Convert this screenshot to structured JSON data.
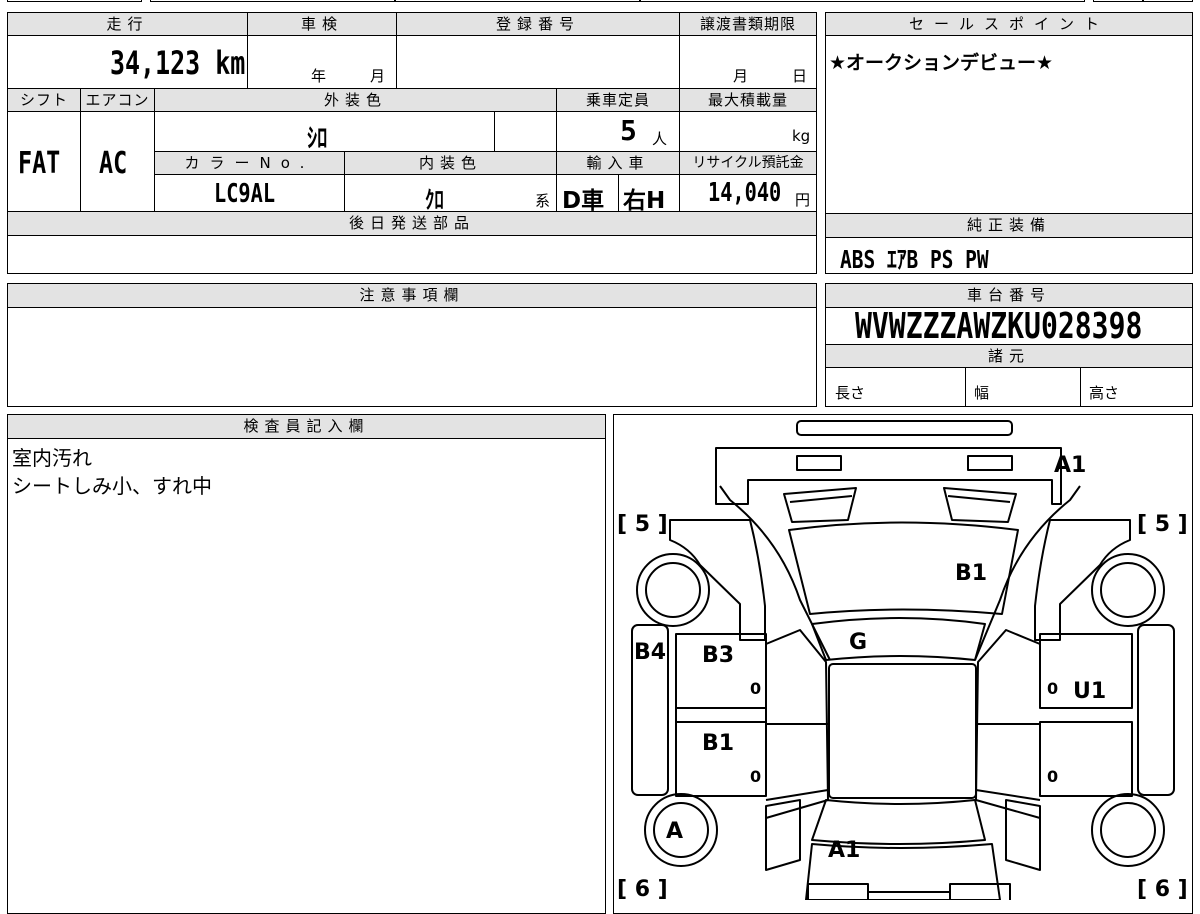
{
  "headers": {
    "mileage": "走行",
    "inspection": "車検",
    "reg_no": "登録番号",
    "transfer_deadline": "譲渡書類期限",
    "sales_point": "セールスポイント",
    "shift": "シフト",
    "aircon": "エアコン",
    "ext_color": "外装色",
    "capacity": "乗車定員",
    "max_load": "最大積載量",
    "color_no": "カラーNo.",
    "int_color": "内装色",
    "import": "輸入車",
    "recycle": "リサイクル預託金",
    "later_parts": "後日発送部品",
    "genuine_equipment": "純正装備",
    "notes": "注意事項欄",
    "chassis_no": "車台番号",
    "specs": "諸元",
    "inspector": "検査員記入欄"
  },
  "values": {
    "mileage": "34,123 km",
    "insp_year_unit": "年",
    "insp_month_unit": "月",
    "deadline_month_unit": "月",
    "deadline_day_unit": "日",
    "sales_point_text": "★オークションデビュー★",
    "shift": "FAT",
    "aircon": "AC",
    "ext_color": "ｼﾛ",
    "capacity": "5",
    "capacity_unit": "人",
    "load_unit": "kg",
    "color_no": "LC9AL",
    "int_color": "ｸﾛ",
    "int_color_suffix": "系",
    "import_type": "D車",
    "steering": "右H",
    "recycle_fee": "14,040",
    "yen_unit": "円",
    "equipment": "ABS ｴｱB PS PW",
    "chassis_no": "WVWZZZAWZKU028398",
    "spec_length": "長さ",
    "spec_width": "幅",
    "spec_height": "高さ",
    "inspector_line1": "室内汚れ",
    "inspector_line2": "シートしみ小、すれ中"
  },
  "diagram": {
    "labels": {
      "a1_top": "A1",
      "b1_hood": "B1",
      "g": "G",
      "b4": "B4",
      "b3": "B3",
      "b1_left": "B1",
      "u1": "U1",
      "a_wheel": "A",
      "a1_rear": "A1",
      "five_left": "[ 5 ]",
      "five_right": "[ 5 ]",
      "six_left": "[ 6 ]",
      "six_right": "[ 6 ]",
      "zero": "0"
    }
  }
}
